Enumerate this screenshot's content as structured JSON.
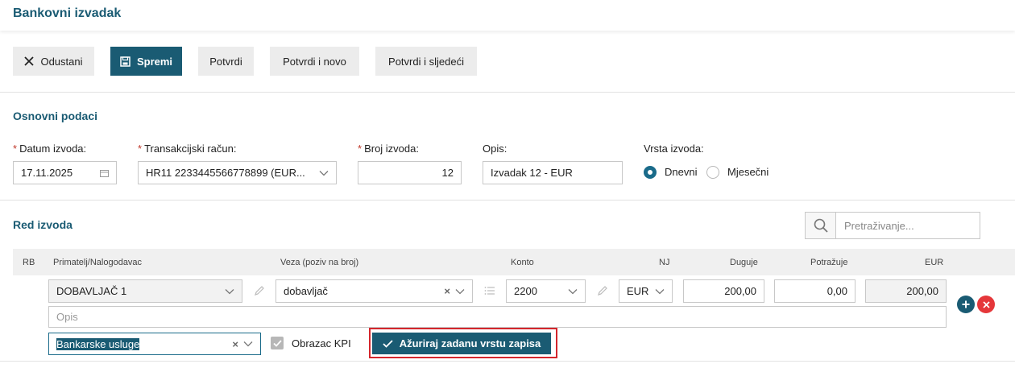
{
  "page": {
    "title": "Bankovni izvadak"
  },
  "toolbar": {
    "cancel_label": "Odustani",
    "save_label": "Spremi",
    "confirm_label": "Potvrdi",
    "confirm_new_label": "Potvrdi i novo",
    "confirm_next_label": "Potvrdi i sljedeći"
  },
  "basic": {
    "section_title": "Osnovni podaci",
    "date_label": "Datum izvoda:",
    "date_value": "17.11.2025",
    "account_label": "Transakcijski račun:",
    "account_value": "HR11 2233445566778899 (EUR...",
    "number_label": "Broj izvoda:",
    "number_value": "12",
    "desc_label": "Opis:",
    "desc_value": "Izvadak 12 - EUR",
    "type_label": "Vrsta izvoda:",
    "type_options": [
      "Dnevni",
      "Mjesečni"
    ],
    "type_selected": "Dnevni",
    "required_mark": "*"
  },
  "lines": {
    "section_title": "Red izvoda",
    "search_placeholder": "Pretraživanje...",
    "columns": {
      "rb": "RB",
      "payee": "Primatelj/Nalogodavac",
      "ref": "Veza (poziv na broj)",
      "account": "Konto",
      "currency": "NJ",
      "debit": "Duguje",
      "credit": "Potražuje",
      "eur": "EUR"
    },
    "row": {
      "payee": "DOBAVLJAČ 1",
      "ref": "dobavljač",
      "account": "2200",
      "currency": "EUR",
      "debit": "200,00",
      "credit": "0,00",
      "eur": "200,00",
      "desc_placeholder": "Opis",
      "record_type": "Bankarske usluge",
      "kpi_label": "Obrazac KPI",
      "kpi_checked": true,
      "update_label": "Ažuriraj zadanu vrstu zapisa"
    }
  },
  "colors": {
    "accent": "#1a5b73",
    "danger": "#e5373a",
    "highlight": "#d4262c"
  }
}
